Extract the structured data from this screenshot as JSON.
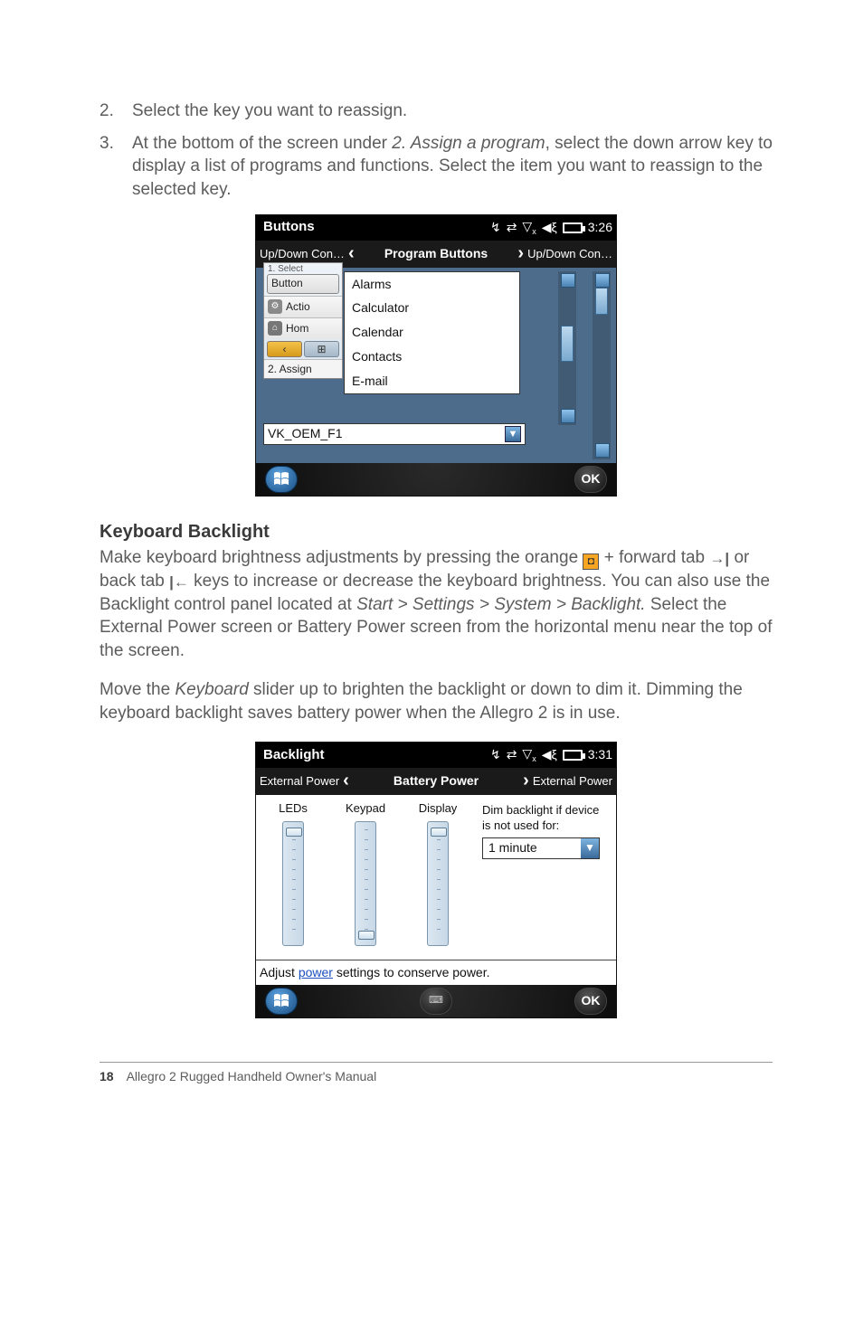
{
  "list": {
    "item2": {
      "num": "2.",
      "text": "Select the key you want to reassign."
    },
    "item3": {
      "num": "3.",
      "pre": "At the bottom of the screen under ",
      "em": "2. Assign a program",
      "post": ", select the down arrow key to display a list of programs and functions. Select the item you want to reassign to the selected key."
    }
  },
  "screen1": {
    "title": "Buttons",
    "time": "3:26",
    "tab_left": "Up/Down Con…",
    "tab_mid": "Program Buttons",
    "tab_right": "Up/Down Con…",
    "panel": {
      "cut": "1. Select",
      "button_label": "Button",
      "action_label": "Actio",
      "home_label": "Hom",
      "assign_label": "2. Assign"
    },
    "dropdown": {
      "opt1": "Alarms",
      "opt2": "Calculator",
      "opt3": "Calendar",
      "opt4": "Contacts",
      "opt5": "E-mail"
    },
    "vk": "VK_OEM_F1",
    "ok": "OK"
  },
  "kb_heading": "Keyboard Backlight",
  "kb_para": {
    "a": "Make keyboard brightness adjustments by pressing the orange ",
    "b": " + forward tab ",
    "c": " or back tab ",
    "d": " keys to increase or decrease the keyboard brightness. You can also use the Backlight control panel located at ",
    "path": "Start > Settings > System > Backlight.",
    "e": " Select the External Power screen or Battery Power screen from the horizontal menu near the top of the screen."
  },
  "kb_para2": {
    "a": "Move the ",
    "em": "Keyboard",
    "b": " slider up to brighten the backlight or down to dim it. Dimming the keyboard backlight saves battery power when the Allegro 2 is in use."
  },
  "screen2": {
    "title": "Backlight",
    "time": "3:31",
    "tab_left": "External Power",
    "tab_mid": "Battery Power",
    "tab_right": "External Power",
    "col1": "LEDs",
    "col2": "Keypad",
    "col3": "Display",
    "dim_label": "Dim backlight if device is not used for:",
    "dim_value": "1 minute",
    "footer_a": "Adjust ",
    "footer_link": "power",
    "footer_b": " settings to conserve power.",
    "ok": "OK"
  },
  "footer": {
    "page": "18",
    "title": "Allegro 2 Rugged Handheld Owner's Manual"
  }
}
